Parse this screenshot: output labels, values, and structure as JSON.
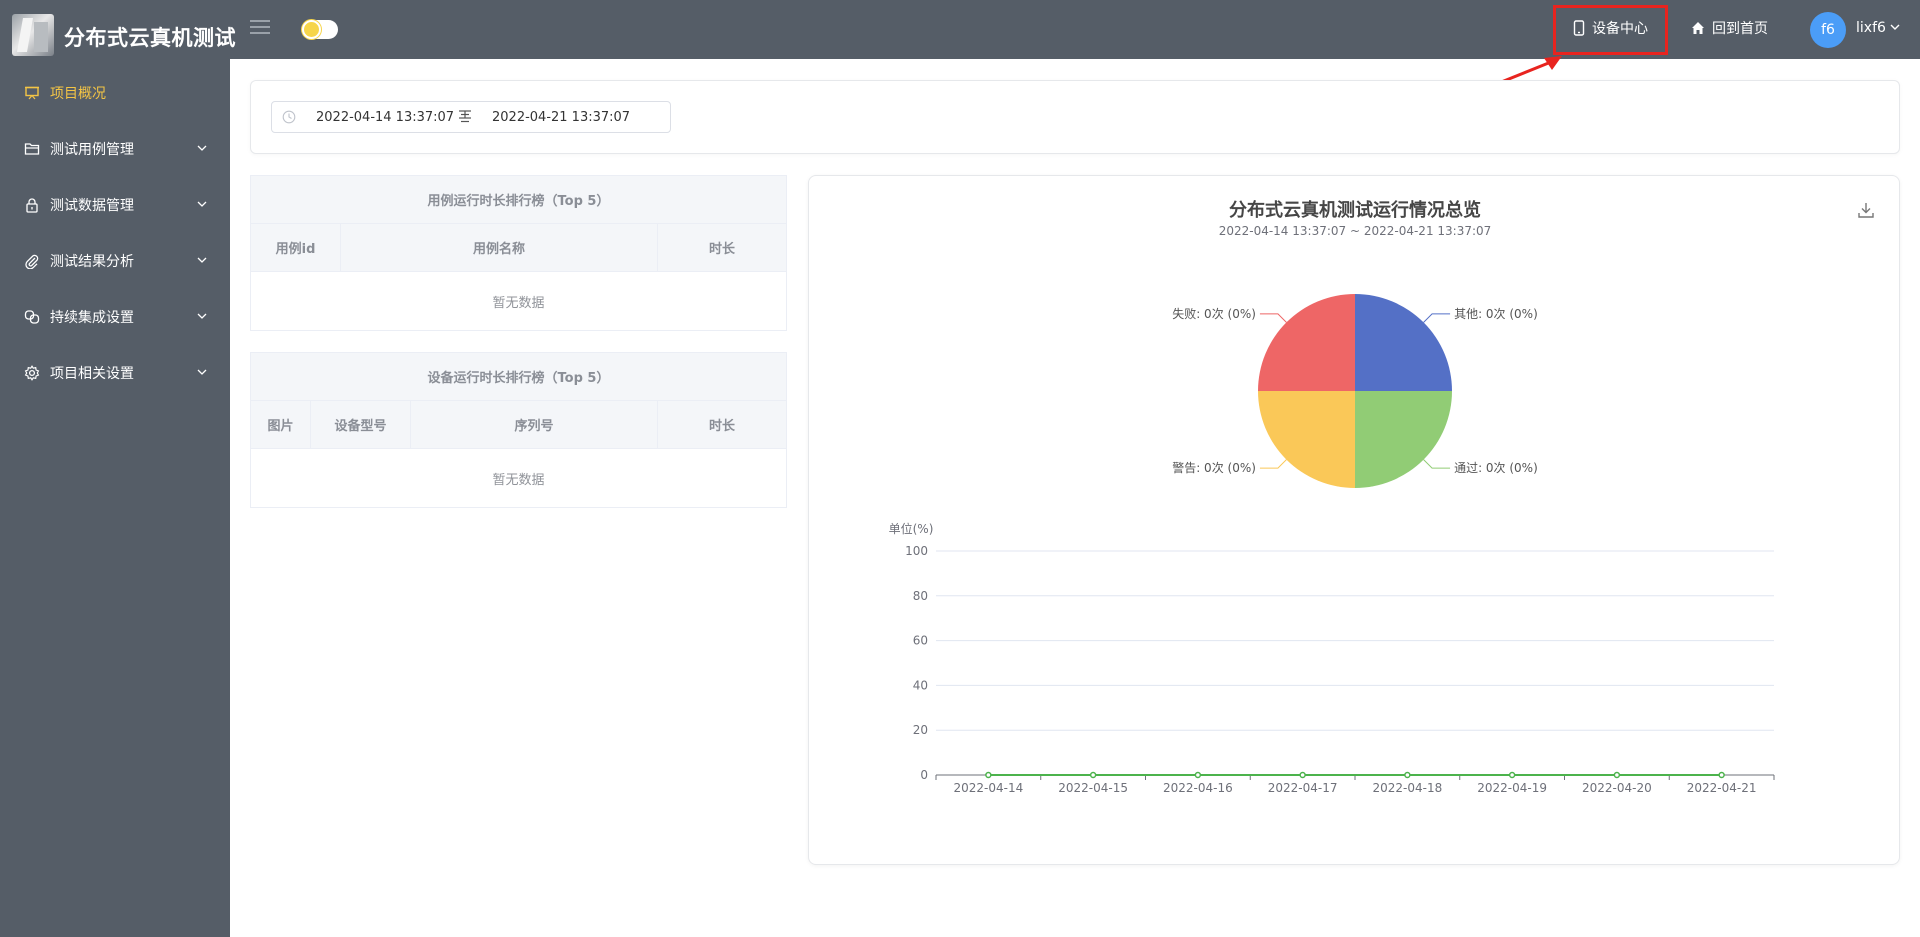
{
  "header": {
    "app_title": "分布式云真机测试",
    "device_center": "设备中心",
    "home_link": "回到首页",
    "avatar_text": "f6",
    "username": "lixf6"
  },
  "sidebar": {
    "items": [
      {
        "label": "项目概况",
        "icon": "presentation-icon",
        "active": true
      },
      {
        "label": "测试用例管理",
        "icon": "folder-icon"
      },
      {
        "label": "测试数据管理",
        "icon": "lock-icon"
      },
      {
        "label": "测试结果分析",
        "icon": "paperclip-icon"
      },
      {
        "label": "持续集成设置",
        "icon": "link-icon"
      },
      {
        "label": "项目相关设置",
        "icon": "gear-icon"
      }
    ]
  },
  "filter": {
    "start": "2022-04-14 13:37:07",
    "end": "2022-04-21 13:37:07"
  },
  "case_table": {
    "title": "用例运行时长排行榜（Top 5）",
    "columns": [
      "用例id",
      "用例名称",
      "时长"
    ],
    "empty": "暂无数据"
  },
  "device_table": {
    "title": "设备运行时长排行榜（Top 5）",
    "columns": [
      "图片",
      "设备型号",
      "序列号",
      "时长"
    ],
    "empty": "暂无数据"
  },
  "chart_panel": {
    "title": "分布式云真机测试运行情况总览",
    "subtitle": "2022-04-14 13:37:07 ~ 2022-04-21 13:37:07"
  },
  "colors": {
    "pass": "#91cc75",
    "warn": "#fac858",
    "fail": "#ee6666",
    "other": "#5470c6",
    "accent": "#f4c545",
    "sidebar_bg": "#555d67"
  },
  "chart_data": [
    {
      "type": "pie",
      "labels": [
        "其他: 0次 (0%)",
        "通过: 0次 (0%)",
        "警告: 0次 (0%)",
        "失败: 0次 (0%)"
      ],
      "categories": [
        "其他",
        "通过",
        "警告",
        "失败"
      ],
      "values": [
        0,
        0,
        0,
        0
      ]
    },
    {
      "type": "line",
      "ylabel": "单位(%)",
      "ylim": [
        0,
        100
      ],
      "yticks": [
        0,
        20,
        40,
        60,
        80,
        100
      ],
      "x": [
        "2022-04-14",
        "2022-04-15",
        "2022-04-16",
        "2022-04-17",
        "2022-04-18",
        "2022-04-19",
        "2022-04-20",
        "2022-04-21"
      ],
      "series": [
        {
          "values": [
            0,
            0,
            0,
            0,
            0,
            0,
            0,
            0
          ]
        }
      ],
      "grid": true
    }
  ]
}
